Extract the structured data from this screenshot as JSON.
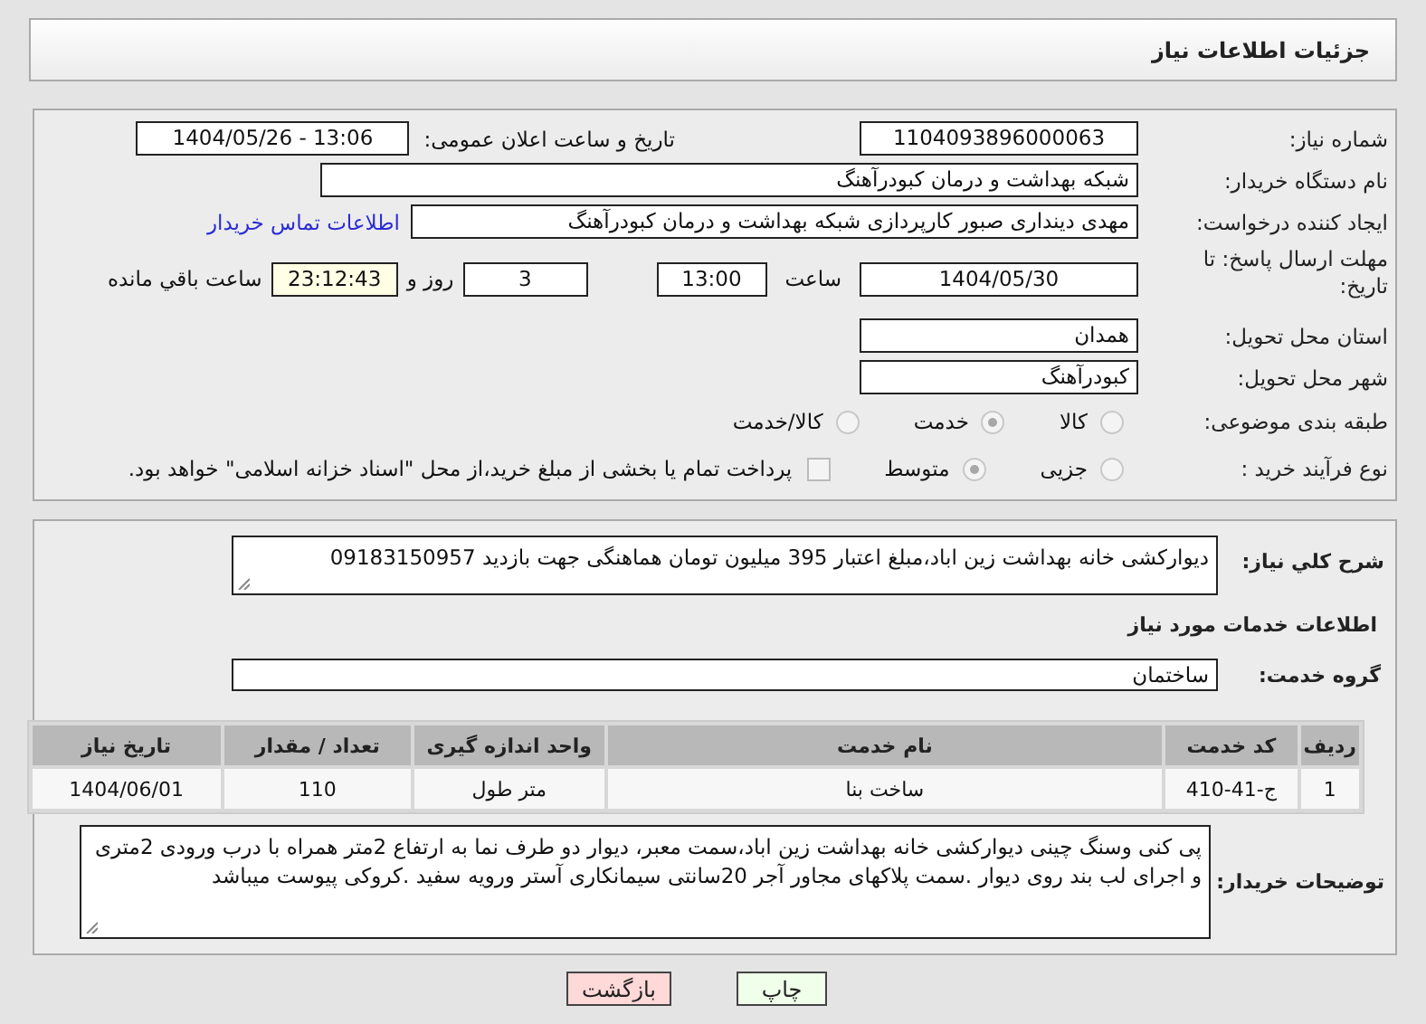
{
  "header": {
    "title": "جزئیات اطلاعات نیاز"
  },
  "need_number": {
    "label": "شماره نیاز:",
    "value": "1104093896000063"
  },
  "announce": {
    "label": "تاریخ و ساعت اعلان عمومی:",
    "value": "1404/05/26 - 13:06"
  },
  "buyer_org": {
    "label": "نام دستگاه خریدار:",
    "value": "شبکه بهداشت و درمان کبودرآهنگ"
  },
  "creator": {
    "label": "ایجاد کننده درخواست:",
    "value": "مهدی دینداری صبور کارپردازی شبکه بهداشت و درمان کبودرآهنگ",
    "contact_link": "اطلاعات تماس خریدار"
  },
  "deadline": {
    "label": "مهلت ارسال پاسخ: تا تاریخ:",
    "date": "1404/05/30",
    "time_label": "ساعت",
    "time": "13:00",
    "days": "3",
    "days_label": "روز و",
    "remaining": "23:12:43",
    "remaining_label": "ساعت باقي مانده"
  },
  "province": {
    "label": "استان محل تحویل:",
    "value": "همدان"
  },
  "city": {
    "label": "شهر محل تحویل:",
    "value": "کبودرآهنگ"
  },
  "category": {
    "label": "طبقه بندی موضوعی:",
    "options": [
      {
        "label": "کالا",
        "selected": false
      },
      {
        "label": "خدمت",
        "selected": true
      },
      {
        "label": "کالا/خدمت",
        "selected": false
      }
    ]
  },
  "process": {
    "label": "نوع فرآیند خرید :",
    "options": [
      {
        "label": "جزیی",
        "selected": false
      },
      {
        "label": "متوسط",
        "selected": true
      }
    ],
    "treasury": {
      "label": "پرداخت تمام یا بخشی از مبلغ خرید،از محل \"اسناد خزانه اسلامی\" خواهد بود.",
      "checked": false
    }
  },
  "description": {
    "label": "شرح کلي نياز:",
    "value": "دیوارکشی خانه بهداشت زین اباد،مبلغ اعتبار 395 میلیون تومان  هماهنگی جهت بازدید 09183150957"
  },
  "services_title": "اطلاعات خدمات مورد نیاز",
  "service_group": {
    "label": "گروه خدمت:",
    "value": "ساختمان"
  },
  "table": {
    "columns": [
      "ردیف",
      "کد خدمت",
      "نام خدمت",
      "واحد اندازه گیری",
      "تعداد / مقدار",
      "تاریخ نیاز"
    ],
    "rows": [
      [
        "1",
        "ج-41-410",
        "ساخت بنا",
        "متر طول",
        "110",
        "1404/06/01"
      ]
    ]
  },
  "buyer_notes": {
    "label": "توضیحات خریدار:",
    "value": "پی کنی وسنگ چینی دیوارکشی خانه بهداشت زین اباد،سمت معبر، دیوار دو طرف نما به ارتفاع 2متر همراه با درب ورودی 2متری و اجرای لب بند روی دیوار .سمت پلاکهای مجاور آجر 20سانتی سیمانکاری آستر ورویه سفید .کروکی پیوست میباشد"
  },
  "buttons": [
    {
      "label": "چاپ",
      "kind": "print"
    },
    {
      "label": "بازگشت",
      "kind": "back"
    }
  ]
}
